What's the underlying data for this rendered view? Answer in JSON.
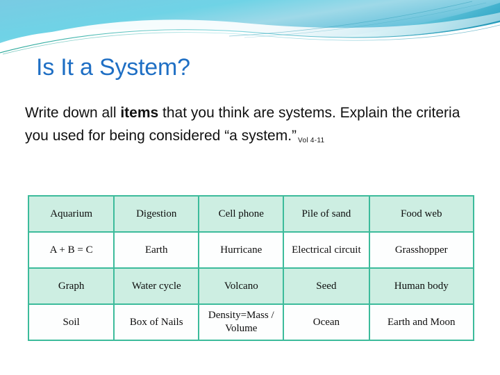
{
  "slide": {
    "title": "Is It a System?",
    "body": {
      "line1_a": "Write down all ",
      "line1_emph": "items",
      "line1_b": " that you think are systems. Explain the criteria you used for being considered “a system.”",
      "reference": "Vol 4-11"
    },
    "theme": {
      "title_color": "#1f6fc4",
      "banner_color_light": "#9fdcea",
      "banner_color_mid": "#55c3dd",
      "banner_color_deep": "#2aa7c4",
      "table_border_color": "#3cbb9b",
      "table_shaded_color": "#cdeee2",
      "table_plain_color": "#fdfefe"
    }
  },
  "table": {
    "rows": [
      {
        "shaded": true,
        "cells": [
          "Aquarium",
          "Digestion",
          "Cell phone",
          "Pile of sand",
          "Food web"
        ]
      },
      {
        "shaded": false,
        "cells": [
          "A + B = C",
          "Earth",
          "Hurricane",
          "Electrical circuit",
          "Grasshopper"
        ]
      },
      {
        "shaded": true,
        "cells": [
          "Graph",
          "Water cycle",
          "Volcano",
          "Seed",
          "Human body"
        ]
      },
      {
        "shaded": false,
        "cells": [
          "Soil",
          "Box of Nails",
          "Density=Mass / Volume",
          "Ocean",
          "Earth and Moon"
        ]
      }
    ]
  }
}
